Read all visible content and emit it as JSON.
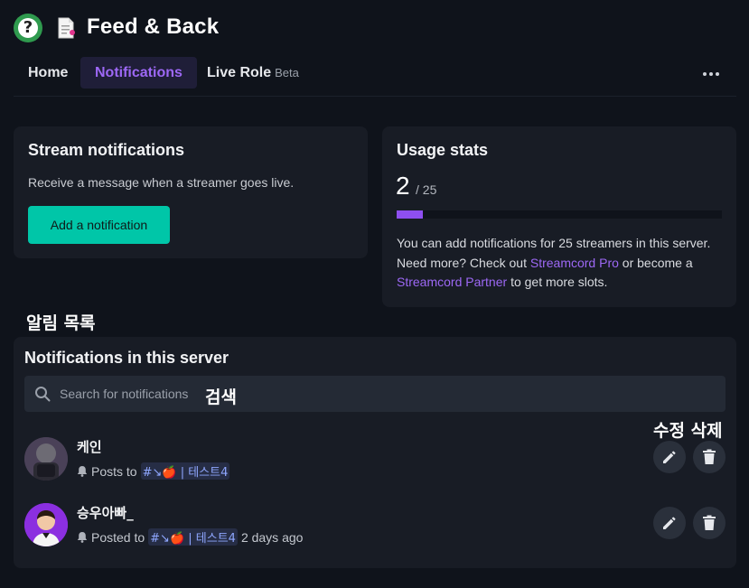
{
  "app": {
    "title": "Feed & Back",
    "logo_icon": "question-mark-logo",
    "doc_icon": "document-icon"
  },
  "tabs": [
    {
      "label": "Home",
      "active": false
    },
    {
      "label": "Notifications",
      "active": true
    },
    {
      "label": "Live Role",
      "badge": "Beta",
      "active": false
    }
  ],
  "stream_card": {
    "title": "Stream notifications",
    "description": "Receive a message when a streamer goes live.",
    "button": "Add a notification"
  },
  "usage": {
    "title": "Usage stats",
    "used": "2",
    "limit": "/ 25",
    "progress_fraction": 0.08,
    "text_1": "You can add notifications for 25 streamers in this server.",
    "text_2": "Need more? Check out",
    "link_pro": "Streamcord Pro",
    "text_3": "or become a",
    "link_partner": "Streamcord Partner",
    "text_4": "to get more slots."
  },
  "annotations": {
    "list_label": "알림 목록",
    "search_label": "검색",
    "actions_label": "수정 삭제"
  },
  "list": {
    "title": "Notifications in this server",
    "search_placeholder": "Search for notifications",
    "rows": [
      {
        "name": "케인",
        "prefix": "Posts to",
        "channel": "#↘🍎 | 테스트4",
        "time": ""
      },
      {
        "name": "승우아빠_",
        "prefix": "Posted to",
        "channel": "#↘🍎 | 테스트4",
        "time": "2 days ago"
      }
    ]
  },
  "colors": {
    "accent": "#9d68f5",
    "button": "#00c6a8",
    "background": "#0f131b",
    "card": "#181c25"
  }
}
